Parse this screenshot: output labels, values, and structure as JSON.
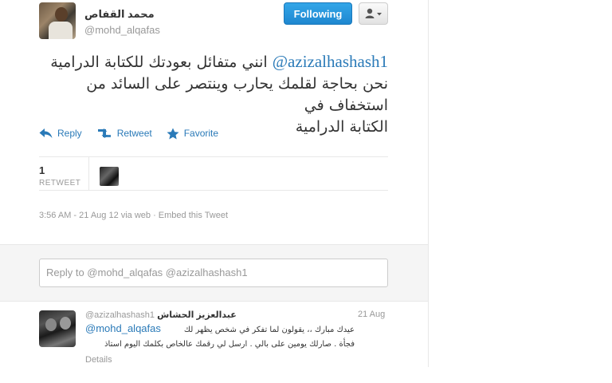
{
  "author": {
    "name": "محمد القفاص",
    "handle": "@mohd_alqafas"
  },
  "follow_button": "Following",
  "tweet": {
    "mention": "@azizalhashash1",
    "text_rest": "انني متفائل بعودتك للكتابة الدرامية",
    "text_line2": "نحن بحاجة لقلمك يحارب وينتصر على السائد من استخفاف في",
    "text_line3": "الكتابة الدرامية"
  },
  "actions": {
    "reply": "Reply",
    "retweet": "Retweet",
    "favorite": "Favorite"
  },
  "stats": {
    "retweet_count": "1",
    "retweet_label": "RETWEET"
  },
  "meta": "3:56 AM - 21 Aug 12 via web · Embed this Tweet",
  "reply_box": {
    "value": "Reply to @mohd_alqafas @azizalhashash1"
  },
  "reply_tweet": {
    "name": "عبدالعزيز الحشاش",
    "handle": "@azizalhashash1",
    "time": "21 Aug",
    "line1": "عيدك مبارك ،، يقولون لما تفكر في شخص يظهر لك",
    "mention": "@mohd_alqafas",
    "line2": "فجأة . صارلك يومين على بالي . ارسل لي رقمك عالخاص بكلمك اليوم استاذ",
    "details": "Details"
  },
  "colors": {
    "link": "#2a7ab8",
    "follow_button": "#2a98df"
  },
  "icons": [
    "user-icon",
    "reply-icon",
    "retweet-icon",
    "favorite-icon"
  ]
}
